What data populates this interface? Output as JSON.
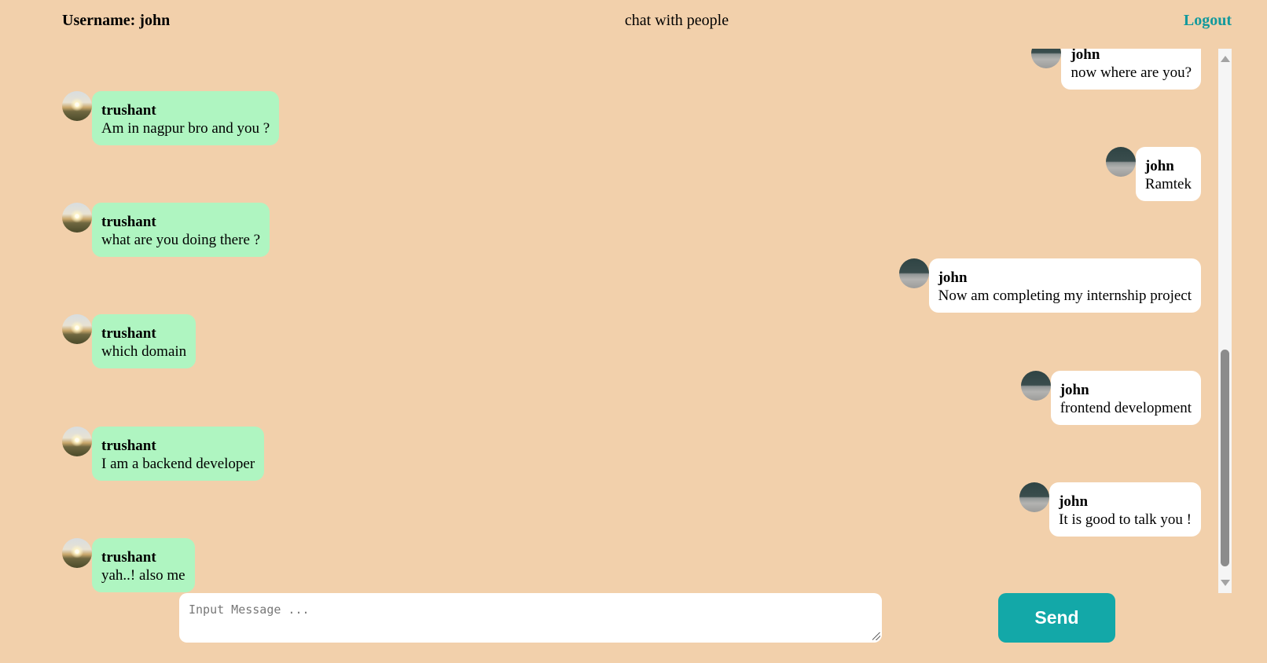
{
  "header": {
    "username_label": "Username: john",
    "title": "chat with people",
    "logout_label": "Logout"
  },
  "messages": [
    {
      "sender": "john",
      "text": "now where are you?",
      "side": "right",
      "avatar": "dark-landscape"
    },
    {
      "sender": "trushant",
      "text": "Am in nagpur bro and you ?",
      "side": "left",
      "avatar": "sunset-landscape"
    },
    {
      "sender": "john",
      "text": "Ramtek",
      "side": "right",
      "avatar": "dark-landscape"
    },
    {
      "sender": "trushant",
      "text": "what are you doing there ?",
      "side": "left",
      "avatar": "sunset-landscape"
    },
    {
      "sender": "john",
      "text": "Now am completing my internship project",
      "side": "right",
      "avatar": "dark-landscape"
    },
    {
      "sender": "trushant",
      "text": "which domain",
      "side": "left",
      "avatar": "sunset-landscape"
    },
    {
      "sender": "john",
      "text": "frontend development",
      "side": "right",
      "avatar": "dark-landscape"
    },
    {
      "sender": "trushant",
      "text": "I am a backend developer",
      "side": "left",
      "avatar": "sunset-landscape"
    },
    {
      "sender": "john",
      "text": "It is good to talk you !",
      "side": "right",
      "avatar": "dark-landscape"
    },
    {
      "sender": "trushant",
      "text": "yah..! also me",
      "side": "left",
      "avatar": "sunset-landscape"
    }
  ],
  "composer": {
    "placeholder": "Input Message ...",
    "value": "",
    "send_label": "Send"
  },
  "colors": {
    "background": "#f2d0ab",
    "incoming_bubble": "#aff5c1",
    "outgoing_bubble": "#ffffff",
    "accent": "#13a8a8",
    "logout": "#13999c"
  }
}
